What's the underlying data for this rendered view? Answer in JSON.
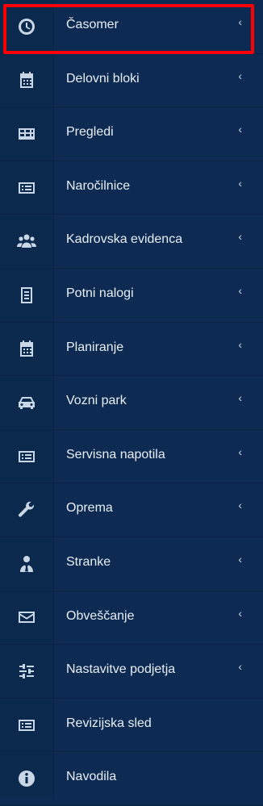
{
  "menu": {
    "items": [
      {
        "label": "Časomer",
        "icon": "clock-icon",
        "has_chevron": true,
        "active": true
      },
      {
        "label": "Delovni bloki",
        "icon": "calendar-icon",
        "has_chevron": true,
        "active": false
      },
      {
        "label": "Pregledi",
        "icon": "table-icon",
        "has_chevron": true,
        "active": false
      },
      {
        "label": "Naročilnice",
        "icon": "list-card-icon",
        "has_chevron": true,
        "active": false
      },
      {
        "label": "Kadrovska evidenca",
        "icon": "users-icon",
        "has_chevron": true,
        "active": false
      },
      {
        "label": "Potni nalogi",
        "icon": "document-icon",
        "has_chevron": true,
        "active": false
      },
      {
        "label": "Planiranje",
        "icon": "calendar-icon",
        "has_chevron": true,
        "active": false
      },
      {
        "label": "Vozni park",
        "icon": "car-icon",
        "has_chevron": true,
        "active": false
      },
      {
        "label": "Servisna napotila",
        "icon": "list-card-icon",
        "has_chevron": true,
        "active": false
      },
      {
        "label": "Oprema",
        "icon": "wrench-icon",
        "has_chevron": true,
        "active": false
      },
      {
        "label": "Stranke",
        "icon": "user-tie-icon",
        "has_chevron": true,
        "active": false
      },
      {
        "label": "Obveščanje",
        "icon": "envelope-icon",
        "has_chevron": true,
        "active": false
      },
      {
        "label": "Nastavitve podjetja",
        "icon": "sliders-icon",
        "has_chevron": true,
        "active": false
      },
      {
        "label": "Revizijska sled",
        "icon": "list-card-icon",
        "has_chevron": false,
        "active": false
      },
      {
        "label": "Navodila",
        "icon": "info-icon",
        "has_chevron": false,
        "active": false
      }
    ],
    "chevron_glyph": "‹"
  },
  "colors": {
    "background": "#0d2b52",
    "icon": "#c9d6e6",
    "text": "#e8eef6",
    "highlight_border": "#ff0000"
  }
}
